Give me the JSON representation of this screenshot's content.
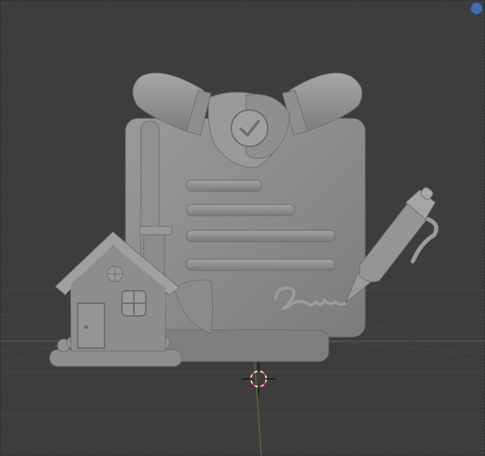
{
  "viewport": {
    "type": "3d-viewport",
    "background_color": "#3d3d3d",
    "grid_line_color": "#474747",
    "x_axis_color": "#8a4b55",
    "y_axis_color": "#5b7a2e",
    "model_color": "#8a8a8a",
    "model_highlight": "#a9a9a9",
    "model_shadow": "#6a6a6a"
  },
  "gizmo": {
    "icon": "navigation-gizmo-dot",
    "color": "#3f6fb0"
  },
  "cursor": {
    "icon": "3d-cursor-icon",
    "color_red": "#d23a3a",
    "color_white": "#f0f0f0"
  },
  "model": {
    "description_icons": [
      "document-icon",
      "handshake-icon",
      "checkmark-icon",
      "house-icon",
      "pen-icon",
      "signature-icon"
    ]
  }
}
